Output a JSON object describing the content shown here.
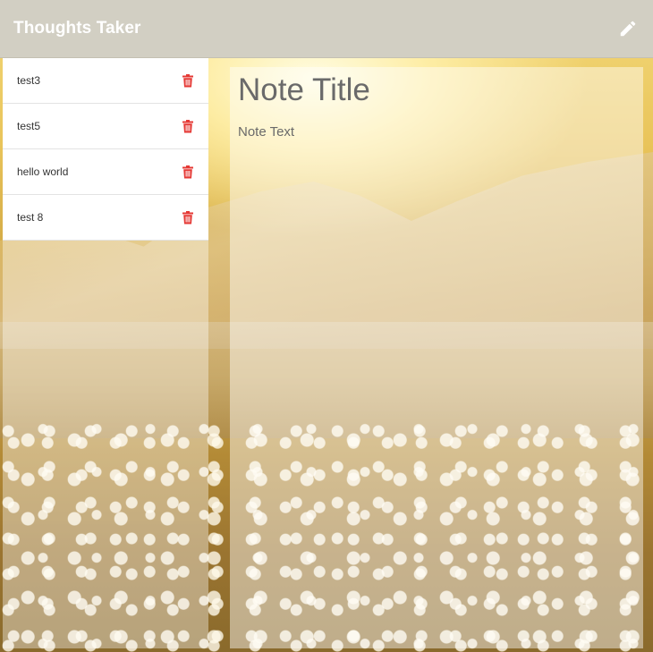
{
  "header": {
    "title": "Thoughts Taker",
    "edit_icon": "pencil-icon"
  },
  "sidebar": {
    "items": [
      {
        "label": "test3",
        "delete_icon": "trash-icon"
      },
      {
        "label": "test5",
        "delete_icon": "trash-icon"
      },
      {
        "label": "hello world",
        "delete_icon": "trash-icon"
      },
      {
        "label": "test 8",
        "delete_icon": "trash-icon"
      }
    ]
  },
  "editor": {
    "title_placeholder": "Note Title",
    "text_placeholder": "Note Text"
  },
  "colors": {
    "header_bg": "#d2cfc3",
    "delete_accent": "#e53935",
    "text": "#6a6a6a"
  }
}
